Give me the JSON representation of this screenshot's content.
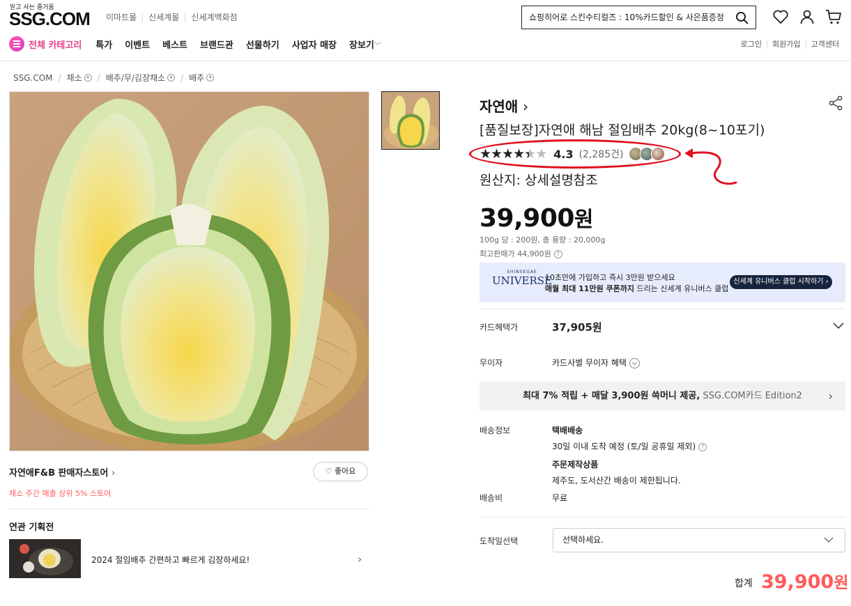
{
  "header": {
    "tagline": "믿고 사는 즐거움",
    "logo": "SSG.COM",
    "sites": [
      "이마트몰",
      "신세계몰",
      "신세계백화점"
    ],
    "search_text": "쇼핑히어로 스킨수티컬즈 : 10%카드할인 & 사은품증정",
    "icons": [
      "search-icon",
      "heart-icon",
      "user-icon",
      "cart-icon"
    ]
  },
  "nav": {
    "all_category": "전체 카테고리",
    "items": [
      "특가",
      "이벤트",
      "베스트",
      "브랜드관",
      "선물하기",
      "사업자 매장",
      "장보기"
    ],
    "user_links": [
      "로그인",
      "회원가입",
      "고객센터"
    ]
  },
  "breadcrumb": [
    "SSG.COM",
    "채소",
    "배추/무/김장채소",
    "배추"
  ],
  "store": {
    "name": "자연애F&B 판매자스토어",
    "sub": "채소 주간 매출 상위 5% 스토어",
    "like_label": "좋아요"
  },
  "related": {
    "title": "연관 기획전",
    "item_text": "2024 절임배추 간편하고 빠르게 김장하세요!"
  },
  "product": {
    "brand": "자연애",
    "title": "[품질보장]자연애 해남 절임배추 20kg(8~10포기)",
    "rating": "4.3",
    "review_count": "(2,285건)",
    "origin": "원산지: 상세설명참조",
    "price_number": "39,900",
    "price_unit": "원",
    "unit_price": "100g 당 : 200원, 총 용량 : 20,000g",
    "original_price": "최고판매가 44,900원"
  },
  "banner": {
    "logo_small": "SHINSEGAE",
    "logo_big": "UNIVERSE",
    "line1": "10초만에 가입하고 즉시 3만원 받으세요",
    "line2_bold": "매월 최대 11만원 쿠폰까지",
    "line2_rest": " 드리는 신세계 유니버스 클럽",
    "cta": "신세계 유니버스 클럽 시작하기 ›"
  },
  "benefits": {
    "card_label": "카드혜택가",
    "card_price": "37,905원",
    "installment_label": "무이자",
    "installment_value": "카드사별 무이자 혜택"
  },
  "promo": {
    "bold": "최대 7% 적립 + 매달 3,900원 쓱머니 제공,",
    "gray": " SSG.COM카드 Edition2"
  },
  "delivery": {
    "info_label": "배송정보",
    "method": "택배배송",
    "eta": "30일 이내 도착 예정 (토/일 공휴일 제외)",
    "made_to_order": "주문제작상품",
    "restriction": "제주도, 도서산간 배송이 제한됩니다.",
    "fee_label": "배송비",
    "fee": "무료"
  },
  "arrival": {
    "label": "도착일선택",
    "placeholder": "선택하세요."
  },
  "total": {
    "label": "합계",
    "amount": "39,900",
    "unit": "원"
  },
  "colors": {
    "accent_pink": "#e23f8a",
    "sale_red": "#ff5b59",
    "annotation_red": "#e0101f",
    "banner_bg": "#e6ecfb",
    "banner_cta": "#17243d"
  }
}
